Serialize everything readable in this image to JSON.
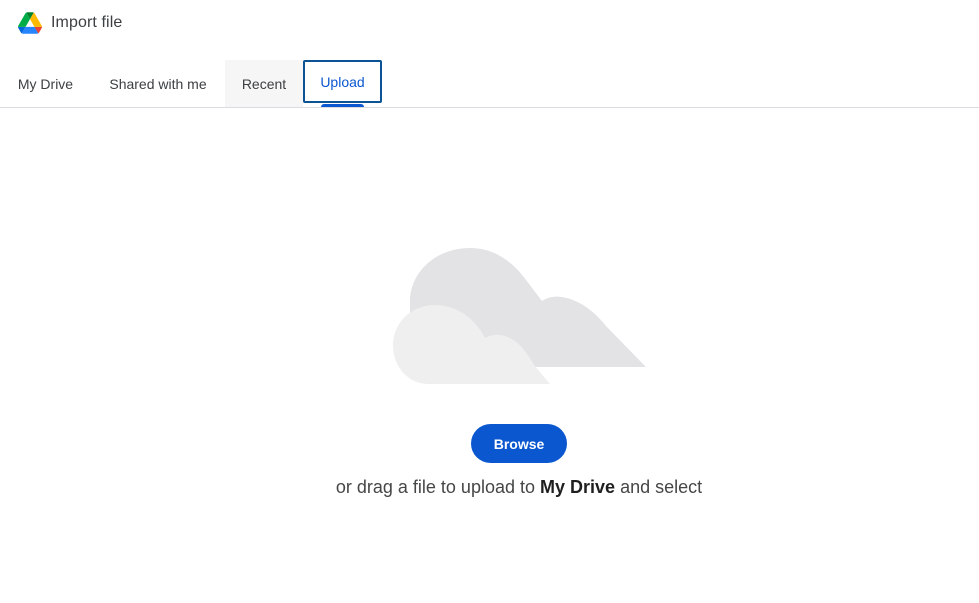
{
  "header": {
    "title": "Import file",
    "logo_icon": "google-drive-logo"
  },
  "tabs": [
    {
      "label": "My Drive",
      "selected": false
    },
    {
      "label": "Shared with me",
      "selected": false
    },
    {
      "label": "Recent",
      "selected": false
    },
    {
      "label": "Upload",
      "selected": true
    }
  ],
  "upload": {
    "illustration": "cloud-illustration",
    "browse_label": "Browse",
    "drag_prefix": "or drag a file to upload to",
    "drag_location": "My Drive",
    "drag_suffix": "and select"
  },
  "colors": {
    "accent": "#0b57d0",
    "focus_outline": "#0b5394",
    "cloud_back": "#e3e3e5",
    "cloud_front": "#efeff0"
  }
}
